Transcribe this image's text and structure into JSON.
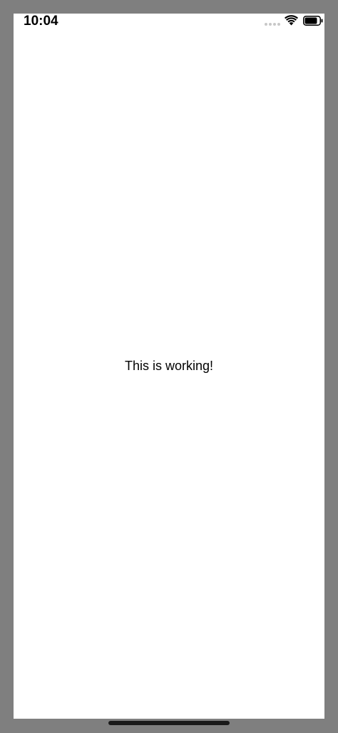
{
  "status_bar": {
    "time": "10:04",
    "signal_icon": "signal-dots-icon",
    "wifi_icon": "wifi-icon",
    "battery_icon": "battery-icon",
    "battery_level": 0.85
  },
  "main": {
    "message": "This is working!"
  },
  "colors": {
    "device_frame": "#7f7f7f",
    "screen_background": "#ffffff",
    "text": "#000000",
    "home_indicator": "#1a1a1a"
  }
}
